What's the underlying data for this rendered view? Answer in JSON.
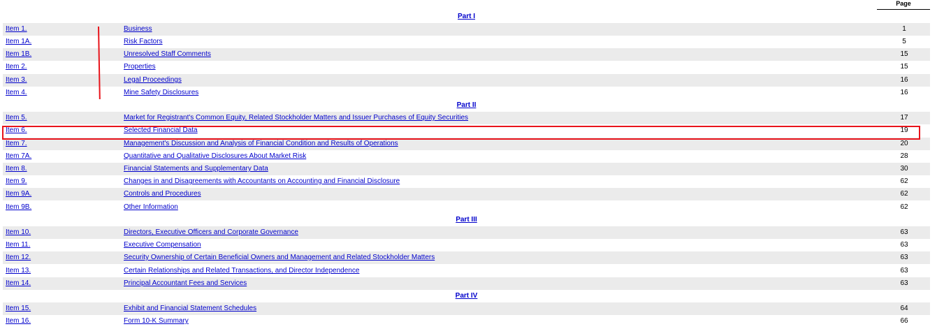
{
  "header": {
    "page_label": "Page"
  },
  "parts": [
    {
      "label": "Part I"
    },
    {
      "label": "Part II"
    },
    {
      "label": "Part III"
    },
    {
      "label": "Part IV"
    }
  ],
  "items": [
    {
      "item": "Item 1.",
      "title": "Business",
      "page": "1"
    },
    {
      "item": "Item 1A.",
      "title": "Risk Factors",
      "page": "5"
    },
    {
      "item": "Item 1B.",
      "title": "Unresolved Staff Comments",
      "page": "15"
    },
    {
      "item": "Item 2.",
      "title": "Properties",
      "page": "15"
    },
    {
      "item": "Item 3.",
      "title": "Legal Proceedings",
      "page": "16"
    },
    {
      "item": "Item 4.",
      "title": "Mine Safety Disclosures",
      "page": "16"
    },
    {
      "item": "Item 5.",
      "title": "Market for Registrant's Common Equity, Related Stockholder Matters and Issuer Purchases of Equity Securities",
      "page": "17"
    },
    {
      "item": "Item 6.",
      "title": "Selected Financial Data",
      "page": "19"
    },
    {
      "item": "Item 7.",
      "title": "Management's Discussion and Analysis of Financial Condition and Results of Operations",
      "page": "20"
    },
    {
      "item": "Item 7A.",
      "title": "Quantitative and Qualitative Disclosures About Market Risk",
      "page": "28"
    },
    {
      "item": "Item 8.",
      "title": "Financial Statements and Supplementary Data",
      "page": "30"
    },
    {
      "item": "Item 9.",
      "title": "Changes in and Disagreements with Accountants on Accounting and Financial Disclosure",
      "page": "62"
    },
    {
      "item": "Item 9A.",
      "title": "Controls and Procedures",
      "page": "62"
    },
    {
      "item": "Item 9B.",
      "title": "Other Information",
      "page": "62"
    },
    {
      "item": "Item 10.",
      "title": "Directors, Executive Officers and Corporate Governance",
      "page": "63"
    },
    {
      "item": "Item 11.",
      "title": "Executive Compensation",
      "page": "63"
    },
    {
      "item": "Item 12.",
      "title": "Security Ownership of Certain Beneficial Owners and Management and Related Stockholder Matters",
      "page": "63"
    },
    {
      "item": "Item 13.",
      "title": "Certain Relationships and Related Transactions, and Director Independence",
      "page": "63"
    },
    {
      "item": "Item 14.",
      "title": "Principal Accountant Fees and Services",
      "page": "63"
    },
    {
      "item": "Item 15.",
      "title": "Exhibit and Financial Statement Schedules",
      "page": "64"
    },
    {
      "item": "Item 16.",
      "title": "Form 10-K Summary",
      "page": "66"
    }
  ],
  "annotations": {
    "color": "#e8141b",
    "highlighted_item": "Item 6."
  },
  "colors": {
    "link": "#0000cc",
    "row_shade": "#ebebeb"
  }
}
